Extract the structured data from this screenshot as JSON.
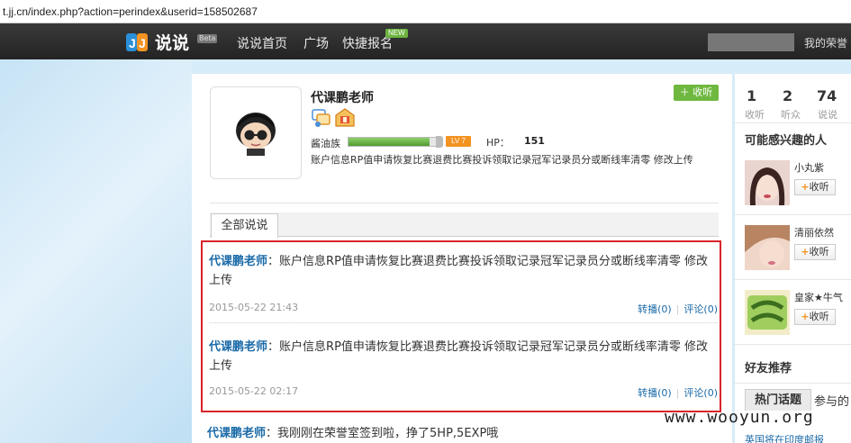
{
  "browser": {
    "url": "t.jj.cn/index.php?action=perindex&userid=158502687"
  },
  "header": {
    "logo_text": "说说",
    "beta": "Beta",
    "nav": [
      "说说首页",
      "广场",
      "快捷报名"
    ],
    "new_badge": "NEW",
    "user_label": "我的荣誉"
  },
  "profile": {
    "name": "代课鹏老师",
    "follow_label": "收听",
    "level_name": "酱油族",
    "exp_progress": 0.92,
    "level_badge": "LV 7",
    "hp_label": "HP：",
    "hp_value": "151",
    "signature": "账户信息RP值申请恢复比赛退费比赛投诉领取记录冠军记录员分或断线率清零 修改上传"
  },
  "tabs": {
    "all_posts": "全部说说"
  },
  "posts": [
    {
      "author": "代课鹏老师",
      "colon": "：",
      "text": "账户信息RP值申请恢复比赛退费比赛投诉领取记录冠军记录员分或断线率清零 修改 上传",
      "time": "2015-05-22 21:43",
      "repost": "转播(0)",
      "comment": "评论(0)"
    },
    {
      "author": "代课鹏老师",
      "colon": "：",
      "text": "账户信息RP值申请恢复比赛退费比赛投诉领取记录冠军记录员分或断线率清零 修改 上传",
      "time": "2015-05-22 02:17",
      "repost": "转播(0)",
      "comment": "评论(0)"
    },
    {
      "author": "代课鹏老师",
      "colon": "：",
      "text": "我刚刚在荣誉室签到啦，挣了5HP,5EXP哦"
    }
  ],
  "sidebar": {
    "stats": [
      {
        "num": "1",
        "label": "收听"
      },
      {
        "num": "2",
        "label": "听众"
      },
      {
        "num": "74",
        "label": "说说"
      }
    ],
    "interest_title": "可能感兴趣的人",
    "recommend": [
      {
        "name": "小丸紫",
        "follow": "收听"
      },
      {
        "name": "清丽依然",
        "follow": "收听"
      },
      {
        "name": "皇家★牛气",
        "follow": "收听"
      }
    ],
    "friends_title": "好友推荐",
    "hot_tab": "热门话题",
    "join_tab": "参与的",
    "hot_item": "英国将在印度邮报"
  },
  "watermark": "www.wooyun.org",
  "colors": {
    "nav_bg": "#2c2c2c",
    "accent_green": "#6fb83f",
    "link_blue": "#1a6aa8",
    "highlight_red": "#d9232a",
    "level_orange": "#f39322"
  }
}
